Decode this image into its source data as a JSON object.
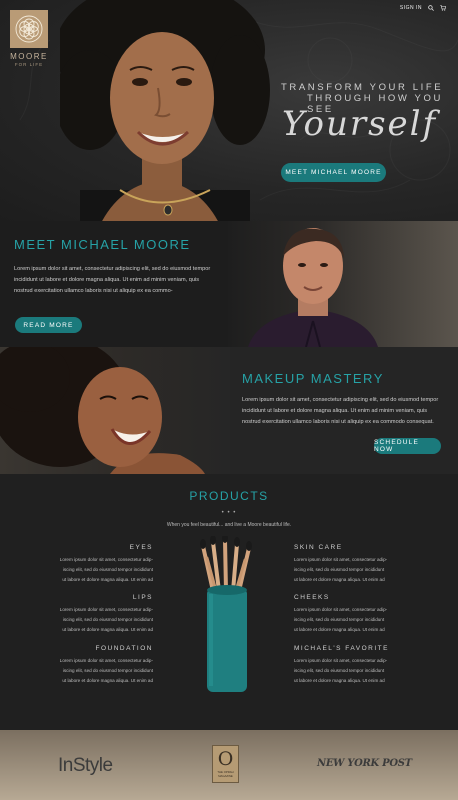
{
  "brand": {
    "name": "MOORE",
    "tagline": "FOR LIFE"
  },
  "nav": {
    "signin": "SIGN IN",
    "search_icon": "search-icon",
    "cart_icon": "cart-icon"
  },
  "hero": {
    "line1": "TRANSFORM YOUR LIFE",
    "line2": "THROUGH HOW YOU SEE",
    "script": "Yourself",
    "button": "MEET MICHAEL MOORE"
  },
  "meet": {
    "title": "MEET MICHAEL MOORE",
    "text": "Lorem ipsum dolor sit amet, consectetur adipiscing elit, sed do eiusmod tempor incididunt ut labore et dolore magna aliqua. Ut enim ad minim veniam, quis nostrud exercitation ullamco laboris nisi ut aliquip ex ea commo-",
    "button": "READ MORE"
  },
  "makeup": {
    "title": "MAKEUP MASTERY",
    "text": "Lorem ipsum dolor sit amet, consectetur adipiscing elit, sed do eiusmod tempor incididunt ut labore et dolore magna aliqua. Ut enim ad minim veniam, quis nostrud exercitation ullamco laboris nisi ut aliquip ex ea commodo consequat.",
    "button": "SCHEDULE NOW"
  },
  "products": {
    "title": "PRODUCTS",
    "dots": "• • •",
    "subtitle": "When you feel beautiful... and live a Moore beautiful life.",
    "categories_left": [
      {
        "heading": "EYES",
        "text": "Lorem ipsum dolor sit amet, consectetur adip- iscing elit, sed do eiusmod tempor incididunt ut labore et dolore magna aliqua. Ut enim ad"
      },
      {
        "heading": "LIPS",
        "text": "Lorem ipsum dolor sit amet, consectetur adip- iscing elit, sed do eiusmod tempor incididunt ut labore et dolore magna aliqua. Ut enim ad"
      },
      {
        "heading": "FOUNDATION",
        "text": "Lorem ipsum dolor sit amet, consectetur adip- iscing elit, sed do eiusmod tempor incididunt ut labore et dolore magna aliqua. Ut enim ad"
      }
    ],
    "categories_right": [
      {
        "heading": "SKIN CARE",
        "text": "Lorem ipsum dolor sit amet, consectetur adip- iscing elit, sed do eiusmod tempor incididunt ut labore et dolore magna aliqua. Ut enim ad"
      },
      {
        "heading": "CHEEKS",
        "text": "Lorem ipsum dolor sit amet, consectetur adip- iscing elit, sed do eiusmod tempor incididunt ut labore et dolore magna aliqua. Ut enim ad"
      },
      {
        "heading": "MICHAEL'S FAVORITE",
        "text": "Lorem ipsum dolor sit amet, consectetur adip- iscing elit, sed do eiusmod tempor incididunt ut labore et dolore magna aliqua. Ut enim ad"
      }
    ]
  },
  "press": {
    "instyle": "InStyle",
    "oprah_letter": "O",
    "oprah_sub": "THE OPRAH MAGAZINE",
    "nypost": "NEW YORK POST"
  },
  "colors": {
    "teal": "#1b7a7c",
    "teal_text": "#26a2a6",
    "gold": "#b99b76"
  }
}
